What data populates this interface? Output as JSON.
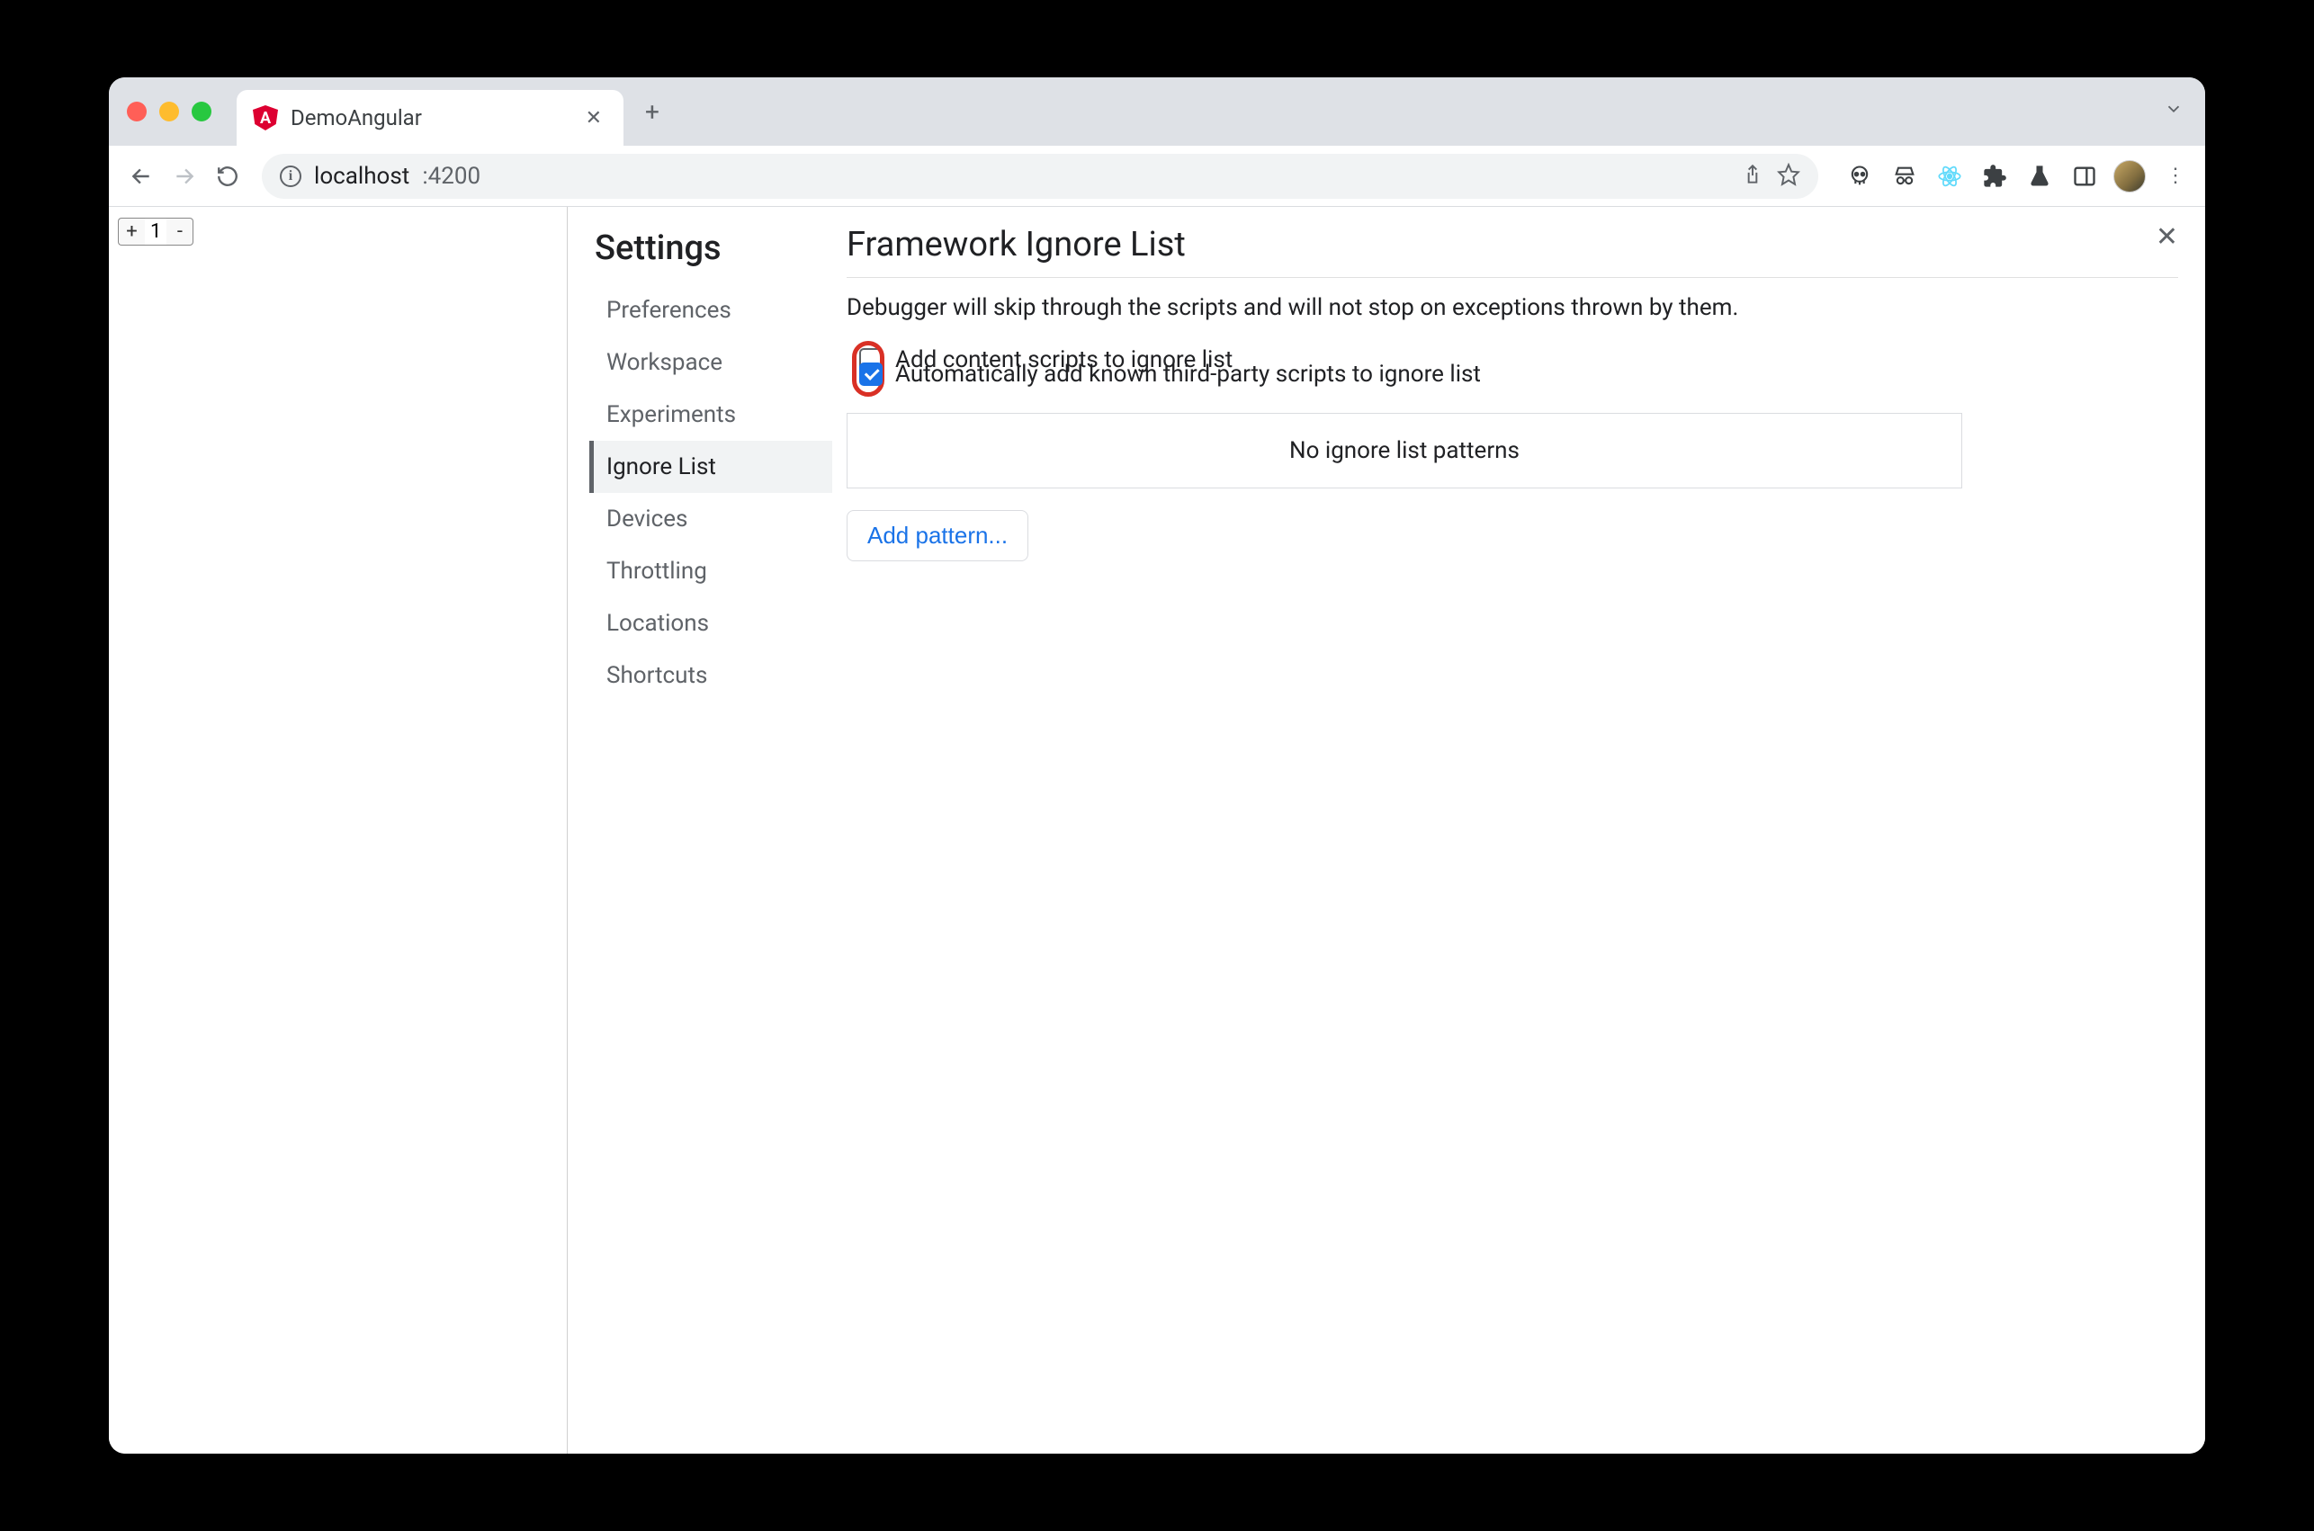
{
  "tab": {
    "title": "DemoAngular",
    "favicon_letter": "A"
  },
  "addressbar": {
    "host": "localhost",
    "port": ":4200"
  },
  "counter": {
    "plus": "+",
    "value": "1",
    "minus": "-"
  },
  "settings": {
    "title": "Settings",
    "nav": {
      "preferences": "Preferences",
      "workspace": "Workspace",
      "experiments": "Experiments",
      "ignore_list": "Ignore List",
      "devices": "Devices",
      "throttling": "Throttling",
      "locations": "Locations",
      "shortcuts": "Shortcuts"
    },
    "active": "ignore_list"
  },
  "panel": {
    "title": "Framework Ignore List",
    "description": "Debugger will skip through the scripts and will not stop on exceptions thrown by them.",
    "checkbox1": {
      "label": "Add content scripts to ignore list",
      "checked": false
    },
    "checkbox2": {
      "label": "Automatically add known third-party scripts to ignore list",
      "checked": true
    },
    "empty_patterns": "No ignore list patterns",
    "add_pattern": "Add pattern..."
  }
}
